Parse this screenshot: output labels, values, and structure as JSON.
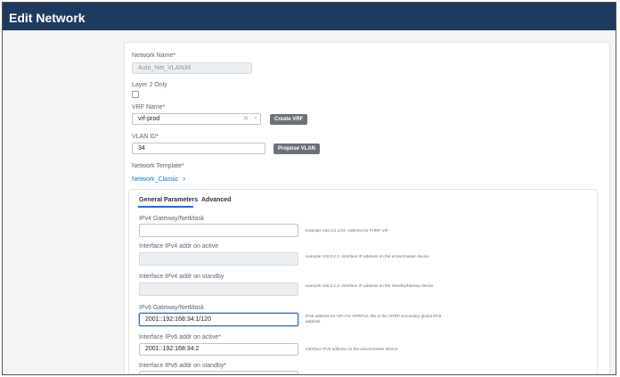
{
  "window": {
    "title": "Edit Network"
  },
  "form": {
    "network_name": {
      "label": "Network Name",
      "value": "Auto_Net_VLAN34"
    },
    "layer2_only": {
      "label": "Layer 2 Only"
    },
    "vrf_name": {
      "label": "VRF Name",
      "value": "vrf-prod",
      "clear_glyph": "✕",
      "chevron_glyph": "⌄",
      "create_button": "Create VRF"
    },
    "vlan_id": {
      "label": "VLAN ID",
      "value": "34",
      "propose_button": "Propose VLAN"
    },
    "network_template": {
      "label": "Network Template",
      "value": "Network_Classic",
      "chevron_glyph": "›"
    },
    "required_marker": "*"
  },
  "tabs": [
    {
      "label": "General Parameters",
      "active": true
    },
    {
      "label": "Advanced",
      "active": false
    }
  ],
  "general": {
    "ipv4_gateway": {
      "label": "IPv4 Gateway/NetMask",
      "value": "",
      "hint": "Example 192.0.2.1/24. Address for FHRP VIP"
    },
    "ipv4_active": {
      "label": "Interface IPv4 addr on active",
      "value": "",
      "hint": "example 192.0.2.2. Interface IP address on the active/master device"
    },
    "ipv4_standby": {
      "label": "Interface IPv4 addr on standby",
      "value": "",
      "hint": "example 192.0.2.3. Interface IP address on the standby/backup device"
    },
    "ipv6_gateway": {
      "label": "IPv6 Gateway/NetMask",
      "value": "2001::192:168:34:1/120",
      "hint": "IPv6 address for VIP. For VRRPv3, this is the VRRP secondary global IPv6 address."
    },
    "ipv6_active": {
      "label": "Interface IPv6 addr on active",
      "value": "2001::192:168:34:2",
      "hint": "Interface IPv6 address on the active/master device."
    },
    "ipv6_standby": {
      "label": "Interface IPv6 addr on standby",
      "value": ""
    }
  },
  "colors": {
    "title_bar": "#1f3a5f",
    "accent": "#2a6bd6",
    "link": "#1e6fb8",
    "required": "#d0312d",
    "button": "#6b7178"
  }
}
